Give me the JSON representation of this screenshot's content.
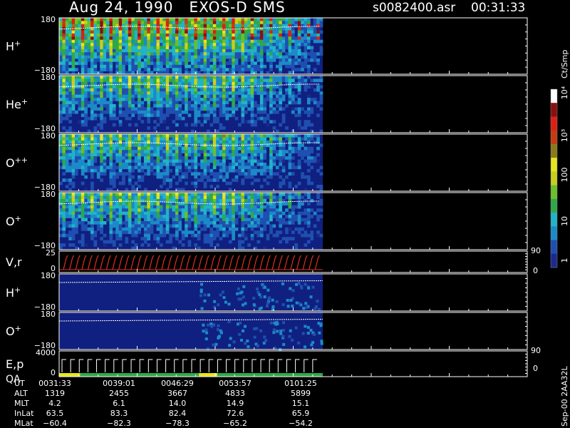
{
  "header": {
    "title": "Aug 24, 1990   EXOS-D SMS",
    "file": "s0082400.asr",
    "time": "00:31:33"
  },
  "side_label": "Sep-00 2AA32L",
  "chart_data": {
    "type": "heatmap",
    "panels": [
      {
        "label_base": "H",
        "label_sup": "+",
        "ytop": "180",
        "ybot": "−180",
        "kind": "spectro",
        "active_until": 1.0
      },
      {
        "label_base": "He",
        "label_sup": "+",
        "ytop": "180",
        "ybot": "−180",
        "kind": "spectro",
        "active_until": 1.0
      },
      {
        "label_base": "O",
        "label_sup": "++",
        "ytop": "180",
        "ybot": "−180",
        "kind": "spectro",
        "active_until": 1.0
      },
      {
        "label_base": "O",
        "label_sup": "+",
        "ytop": "180",
        "ybot": "−180",
        "kind": "spectro",
        "active_until": 1.0
      },
      {
        "label_base": "V,r",
        "label_sup": "",
        "ytop": "25",
        "ybot": "0",
        "kind": "line",
        "right_top": "90",
        "right_bot": "0"
      },
      {
        "label_base": "H",
        "label_sup": "+",
        "ytop": "180",
        "ybot": "−180",
        "kind": "dark"
      },
      {
        "label_base": "O",
        "label_sup": "+",
        "ytop": "180",
        "ybot": "−180",
        "kind": "dark"
      },
      {
        "label_base": "E,p",
        "label_sup": "",
        "label2": "QA",
        "ytop": "4000",
        "ybot": "0",
        "kind": "line2",
        "right_top": "90",
        "right_bot": "0"
      }
    ],
    "colorbar": {
      "unit": "Ct/Smp",
      "ticks": [
        "1",
        "10",
        "100",
        "10³",
        "10⁴"
      ],
      "tick_values": [
        1,
        10,
        100,
        1000,
        10000
      ]
    },
    "colors": {
      "background": "#000000",
      "low": "#102080",
      "scale": [
        "#1a2a8c",
        "#1f4fb0",
        "#1c8ac8",
        "#20b4c8",
        "#2fa84a",
        "#6cc02a",
        "#c8d01a",
        "#e6e61c",
        "#8a7a1a",
        "#c83a10",
        "#e01e14",
        "#8a1010",
        "#ffffff"
      ],
      "lines": "#e03020"
    },
    "data_end_time": "01:07:20",
    "time_columns": [
      {
        "UT": "0031:33",
        "ALT": "1319",
        "MLT": "4.2",
        "InLat": "63.5",
        "MLat": "−60.4"
      },
      {
        "UT": "0039:01",
        "ALT": "2455",
        "MLT": "6.1",
        "InLat": "83.3",
        "MLat": "−82.3"
      },
      {
        "UT": "0046:29",
        "ALT": "3667",
        "MLT": "14.0",
        "InLat": "82.4",
        "MLat": "−78.3"
      },
      {
        "UT": "0053:57",
        "ALT": "4833",
        "MLT": "14.9",
        "InLat": "72.6",
        "MLat": "−65.2"
      },
      {
        "UT": "0101:25",
        "ALT": "5899",
        "MLT": "15.1",
        "InLat": "65.9",
        "MLat": "−54.2"
      }
    ],
    "row_labels": [
      "UT",
      "ALT",
      "MLT",
      "InLat",
      "MLat"
    ]
  }
}
